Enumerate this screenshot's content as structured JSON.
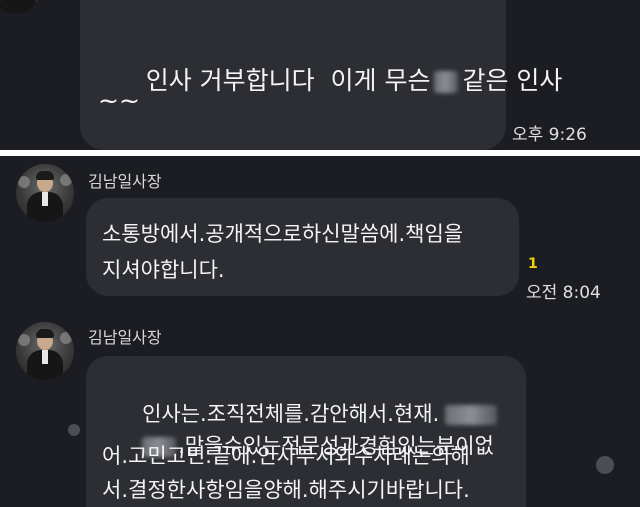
{
  "messages": {
    "outgoing": {
      "line1": "인사 거부합니다  이게 무슨",
      "line1_end": "같은 인사",
      "line2": "~~",
      "time": "오후 9:26"
    },
    "incoming1": {
      "sender": "김남일사장",
      "line1": "소통방에서.공개적으로하신말씀에.책임을",
      "line2": "지셔야합니다.",
      "unread": "1",
      "time": "오전 8:04"
    },
    "incoming2": {
      "sender": "김남일사장",
      "line1": "인사는.조직전체를.감안해서.현재.",
      "line2": ".맡을수있는적문성과경험있는분이없",
      "line3": "어.고민고민.끝에.인사부서와수차례논의해",
      "line4": "서.결정한사항임을양해.해주시기바랍니다."
    }
  },
  "colors": {
    "background": "#1b1d22",
    "bubble": "#2c2e33",
    "text": "#f4f4f4",
    "unread": "#f4d400"
  },
  "icons": {
    "avatar": "profile-photo-man-in-suit"
  }
}
